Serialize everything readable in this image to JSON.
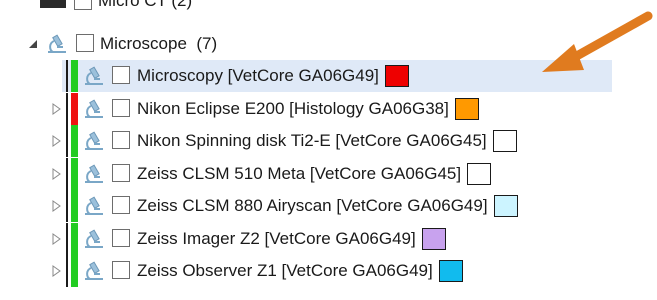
{
  "parent_partial": {
    "label": "Micro CT (2)"
  },
  "group": {
    "label": "Microscope",
    "count": "(7)"
  },
  "items": [
    {
      "label": "Microscopy [VetCore GA06G49]",
      "status_color": "#22cc22",
      "swatch_color": "#ee0000",
      "selected": true
    },
    {
      "label": "Nikon Eclipse E200 [Histology GA06G38]",
      "status_color": "#ee1111",
      "swatch_color": "#ff9900",
      "selected": false
    },
    {
      "label": "Nikon Spinning disk Ti2-E [VetCore GA06G45]",
      "status_color": "#22cc22",
      "swatch_color": "#ffffff",
      "selected": false
    },
    {
      "label": "Zeiss CLSM 510 Meta [VetCore GA06G45]",
      "status_color": "#22cc22",
      "swatch_color": "#ffffff",
      "selected": false
    },
    {
      "label": "Zeiss CLSM 880 Airyscan [VetCore GA06G49]",
      "status_color": "#22cc22",
      "swatch_color": "#ccf4ff",
      "selected": false
    },
    {
      "label": "Zeiss Imager Z2 [VetCore GA06G49]",
      "status_color": "#22cc22",
      "swatch_color": "#c8a2ee",
      "selected": false
    },
    {
      "label": "Zeiss Observer Z1 [VetCore GA06G49]",
      "status_color": "#22cc22",
      "swatch_color": "#11bbee",
      "selected": false
    }
  ],
  "annotation": {
    "color": "#e07b1f"
  },
  "icons": {
    "instrument": "microscope-icon",
    "expand": "chevron-right-icon",
    "collapse": "triangle-down-icon"
  }
}
